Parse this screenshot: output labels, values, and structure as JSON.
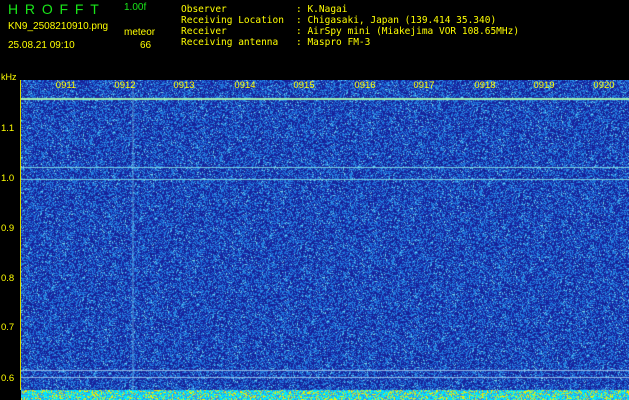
{
  "header": {
    "app_title": "HROFFT",
    "version": "1.00f",
    "filename": "KN9_2508210910.png",
    "timestamp": "25.08.21 09:10",
    "mode": "meteor",
    "count": "66"
  },
  "info": [
    {
      "label": "Observer",
      "value": ": K.Nagai"
    },
    {
      "label": "Receiving Location",
      "value": ": Chigasaki, Japan (139.414 35.340)"
    },
    {
      "label": "Receiver",
      "value": ": AirSpy mini (Miakejima VOR 108.65MHz)"
    },
    {
      "label": "Receiving antenna",
      "value": ": Maspro FM-3"
    }
  ],
  "axis": {
    "y_unit": "kHz",
    "y_ticks": [
      "1.1",
      "1.0",
      "0.9",
      "0.8",
      "0.7",
      "0.6"
    ],
    "x_ticks": [
      "0911",
      "0912",
      "0913",
      "0914",
      "0915",
      "0916",
      "0917",
      "0918",
      "0919",
      "0920"
    ]
  },
  "colors": {
    "background": "#000000",
    "label": "#ffff00",
    "title": "#19e619",
    "waterfall_base": "#1a1f9a",
    "trace": "#7fe0a0"
  },
  "chart_data": {
    "type": "heatmap",
    "ylabel": "kHz",
    "ylim": [
      0.6,
      1.12
    ],
    "y_ticks": [
      1.1,
      1.0,
      0.9,
      0.8,
      0.7,
      0.6
    ],
    "x_ticks": [
      "0911",
      "0912",
      "0913",
      "0914",
      "0915",
      "0916",
      "0917",
      "0918",
      "0919",
      "0920"
    ],
    "carrier_lines_khz": [
      1.11,
      0.99,
      0.97
    ],
    "grid": false
  }
}
